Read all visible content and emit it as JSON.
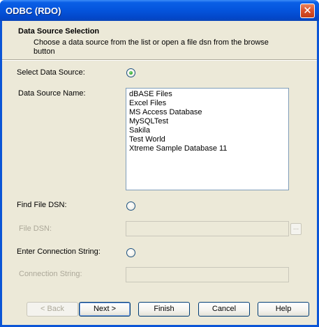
{
  "window": {
    "title": "ODBC (RDO)"
  },
  "header": {
    "title": "Data Source Selection",
    "description": "Choose a data source from the list or open a file dsn from the browse button"
  },
  "select_data_source": {
    "label": "Select Data Source:",
    "selected": true
  },
  "data_source_name": {
    "label": "Data Source Name:",
    "items": [
      "dBASE Files",
      "Excel Files",
      "MS Access Database",
      "MySQLTest",
      "Sakila",
      "Test World",
      "Xtreme Sample Database 11"
    ]
  },
  "find_file_dsn": {
    "label": "Find File DSN:",
    "selected": false
  },
  "file_dsn": {
    "label": "File DSN:",
    "value": "",
    "browse_label": "..."
  },
  "enter_connection_string": {
    "label": "Enter Connection String:",
    "selected": false
  },
  "connection_string": {
    "label": "Connection String:",
    "value": ""
  },
  "buttons": {
    "back": "< Back",
    "next": "Next >",
    "finish": "Finish",
    "cancel": "Cancel",
    "help": "Help"
  },
  "close_icon": "close-icon"
}
